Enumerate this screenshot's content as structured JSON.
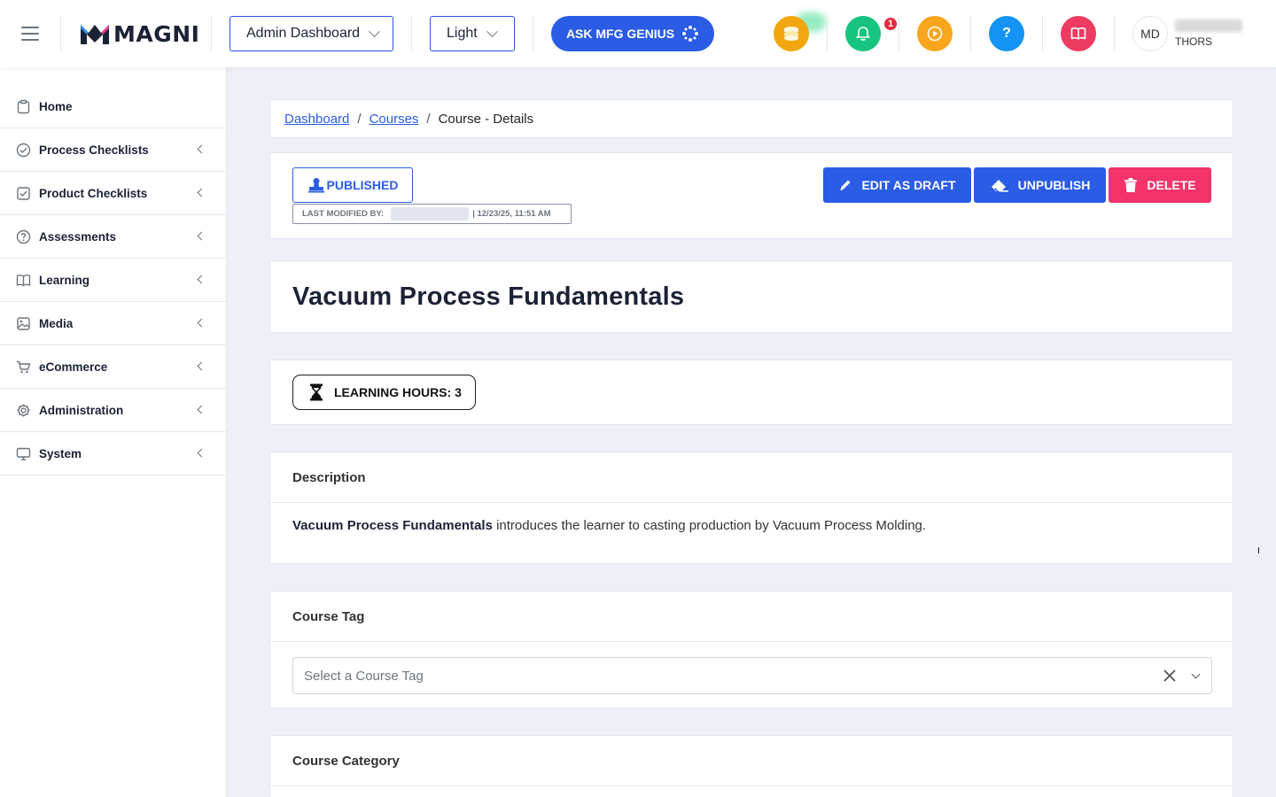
{
  "header": {
    "brand": "MAGNI",
    "dashboard_select": "Admin Dashboard",
    "theme_select": "Light",
    "genius_label": "ASK MFG GENIUS",
    "notification_count": "1",
    "help_label": "?",
    "avatar_initials": "MD",
    "user_org": "THORS"
  },
  "sidebar": {
    "items": [
      {
        "label": "Home"
      },
      {
        "label": "Process Checklists"
      },
      {
        "label": "Product Checklists"
      },
      {
        "label": "Assessments"
      },
      {
        "label": "Learning"
      },
      {
        "label": "Media"
      },
      {
        "label": "eCommerce"
      },
      {
        "label": "Administration"
      },
      {
        "label": "System"
      }
    ]
  },
  "breadcrumb": {
    "dashboard": "Dashboard",
    "courses": "Courses",
    "current": "Course - Details"
  },
  "status": {
    "published_label": "PUBLISHED",
    "last_modified_label": "LAST MODIFIED BY:",
    "last_modified_time": "| 12/23/25, 11:51 AM",
    "edit_label": "EDIT AS DRAFT",
    "unpublish_label": "UNPUBLISH",
    "delete_label": "DELETE"
  },
  "course": {
    "title": "Vacuum Process Fundamentals",
    "learning_hours": "LEARNING HOURS: 3",
    "description_heading": "Description",
    "description_bold": "Vacuum Process Fundamentals",
    "description_rest": " introduces the learner to casting production by Vacuum Process Molding.",
    "tag_heading": "Course Tag",
    "tag_placeholder": "Select a Course Tag",
    "category_heading": "Course Category"
  },
  "colors": {
    "primary": "#2b5ce6",
    "danger": "#f5336b",
    "coins": "#f2a70f",
    "bell": "#16c47f",
    "video": "#f9a61c",
    "help": "#1594f5",
    "book": "#ee3b62"
  }
}
